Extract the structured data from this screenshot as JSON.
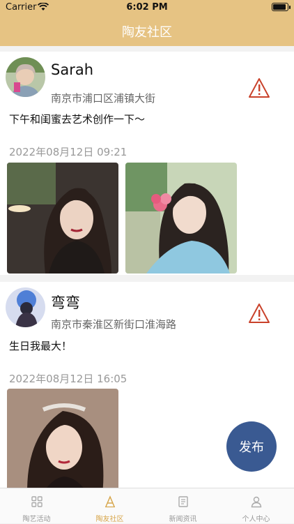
{
  "status": {
    "carrier": "Carrier",
    "time": "6:02 PM"
  },
  "header": {
    "title": "陶友社区"
  },
  "posts": [
    {
      "name": "Sarah",
      "address": "南京市浦口区浦镇大街",
      "content": "下午和闺蜜去艺术创作一下～",
      "date": "2022年08月12日 09:21"
    },
    {
      "name": "弯弯",
      "address": "南京市秦淮区新街口淮海路",
      "content": "生日我最大！",
      "date": "2022年08月12日 16:05"
    }
  ],
  "fab": {
    "label": "发布"
  },
  "tabs": [
    {
      "label": "陶艺活动"
    },
    {
      "label": "陶友社区"
    },
    {
      "label": "新闻资讯"
    },
    {
      "label": "个人中心"
    }
  ],
  "colors": {
    "header": "#e6c383",
    "accent": "#d7a64c",
    "fab": "#3a5a92"
  }
}
